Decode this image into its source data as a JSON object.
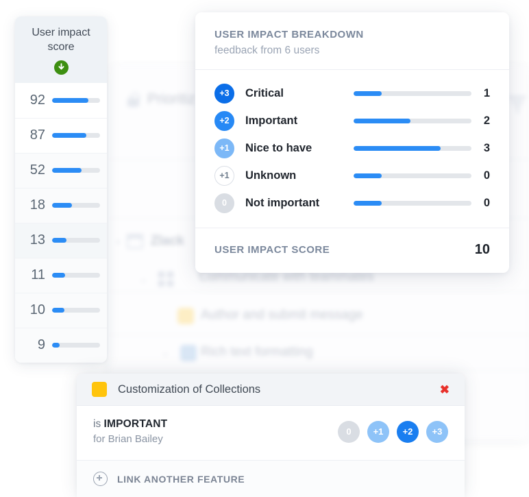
{
  "score_sidebar": {
    "header_title": "User impact score",
    "sort_icon": "arrow-down-icon",
    "sort_direction": "descending",
    "rows": [
      {
        "value": "92",
        "fill_pct": 75
      },
      {
        "value": "87",
        "fill_pct": 72
      },
      {
        "value": "52",
        "fill_pct": 62
      },
      {
        "value": "18",
        "fill_pct": 41
      },
      {
        "value": "13",
        "fill_pct": 30
      },
      {
        "value": "11",
        "fill_pct": 27
      },
      {
        "value": "10",
        "fill_pct": 25
      },
      {
        "value": "9",
        "fill_pct": 15
      }
    ]
  },
  "breakdown": {
    "title": "USER IMPACT BREAKDOWN",
    "subtitle": "feedback from 6 users",
    "rows": [
      {
        "badge": "+3",
        "label": "Critical",
        "fill_pct": 24,
        "count": "1",
        "badge_bg": "#0b6ee8",
        "badge_border": "#0b6ee8",
        "badge_color": "#ffffff"
      },
      {
        "badge": "+2",
        "label": "Important",
        "fill_pct": 48,
        "count": "2",
        "badge_bg": "#2789f5",
        "badge_border": "#2789f5",
        "badge_color": "#ffffff"
      },
      {
        "badge": "+1",
        "label": "Nice to have",
        "fill_pct": 74,
        "count": "3",
        "badge_bg": "#7cb8f7",
        "badge_border": "#7cb8f7",
        "badge_color": "#ffffff"
      },
      {
        "badge": "+1",
        "label": "Unknown",
        "fill_pct": 24,
        "count": "0",
        "badge_bg": "#ffffff",
        "badge_border": "#dbdfe6",
        "badge_color": "#72808f"
      },
      {
        "badge": "0",
        "label": "Not important",
        "fill_pct": 24,
        "count": "0",
        "badge_bg": "#d9dde3",
        "badge_border": "#d9dde3",
        "badge_color": "#ffffff"
      }
    ],
    "footer_label": "USER IMPACT SCORE",
    "footer_value": "10"
  },
  "feature_card": {
    "swatch_color": "#ffc40c",
    "title": "Customization of Collections",
    "close_label": "✖",
    "is_word": "is",
    "level_word": "IMPORTANT",
    "for_line": "for Brian Bailey",
    "options": [
      {
        "label": "0",
        "bg": "#d9dde3",
        "color": "#ffffff",
        "selected": false
      },
      {
        "label": "+1",
        "bg": "#8ec3f8",
        "color": "#ffffff",
        "selected": false
      },
      {
        "label": "+2",
        "bg": "#1a7ef0",
        "color": "#ffffff",
        "selected": true
      },
      {
        "label": "+3",
        "bg": "#8ec3f8",
        "color": "#ffffff",
        "selected": false
      }
    ],
    "footer_label": "LINK ANOTHER FEATURE",
    "footer_icon": "plus-circle-icon"
  },
  "background": {
    "locked_row_label": "Prioritiz",
    "tree_rows": [
      "Zlack",
      "Communicate with teammates",
      "Author and submit message",
      "Rich text formatting"
    ],
    "filter_icon": "filter-icon",
    "lock_icon": "lock-icon"
  },
  "colors": {
    "accent_blue": "#2b8cf5",
    "track_gray": "#e3e6ea",
    "sort_green": "#3d8f11",
    "close_red": "#e8302a",
    "yellow_swatch": "#ffc40c"
  }
}
